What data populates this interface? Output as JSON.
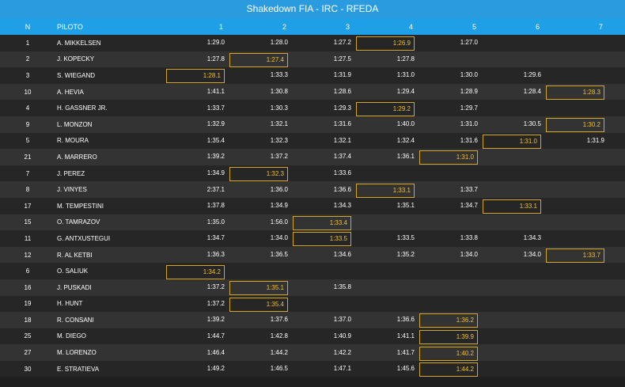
{
  "title": "Shakedown FIA - IRC - RFEDA",
  "header": {
    "n": "N",
    "piloto": "PILOTO",
    "cols": [
      "1",
      "2",
      "3",
      "4",
      "5",
      "6",
      "7"
    ]
  },
  "rows": [
    {
      "n": "1",
      "name": "A. MIKKELSEN",
      "t": [
        "1:29.0",
        "1:28.0",
        "1:27.2",
        "1:26.9",
        "1:27.0",
        "",
        ""
      ],
      "best": 3
    },
    {
      "n": "2",
      "name": "J. KOPECKY",
      "t": [
        "1:27.8",
        "1:27.4",
        "1:27.5",
        "1:27.8",
        "",
        "",
        ""
      ],
      "best": 1
    },
    {
      "n": "3",
      "name": "S. WIEGAND",
      "t": [
        "1:28.1",
        "1:33.3",
        "1:31.9",
        "1:31.0",
        "1:30.0",
        "1:29.6",
        ""
      ],
      "best": 0
    },
    {
      "n": "10",
      "name": "A. HEVIA",
      "t": [
        "1:41.1",
        "1:30.8",
        "1:28.6",
        "1:29.4",
        "1:28.9",
        "1:28.4",
        "1:28.3"
      ],
      "best": 6
    },
    {
      "n": "4",
      "name": "H. GASSNER JR.",
      "t": [
        "1:33.7",
        "1:30.3",
        "1:29.3",
        "1:29.2",
        "1:29.7",
        "",
        ""
      ],
      "best": 3
    },
    {
      "n": "9",
      "name": "L. MONZON",
      "t": [
        "1:32.9",
        "1:32.1",
        "1:31.6",
        "1:40.0",
        "1:31.0",
        "1:30.5",
        "1:30.2"
      ],
      "best": 6
    },
    {
      "n": "5",
      "name": "R. MOURA",
      "t": [
        "1:35.4",
        "1:32.3",
        "1:32.1",
        "1:32.4",
        "1:31.6",
        "1:31.0",
        "1:31.9"
      ],
      "best": 5
    },
    {
      "n": "21",
      "name": "A. MARRERO",
      "t": [
        "1:39.2",
        "1:37.2",
        "1:37.4",
        "1:36.1",
        "1:31.0",
        "",
        ""
      ],
      "best": 4
    },
    {
      "n": "7",
      "name": "J. PEREZ",
      "t": [
        "1:34.9",
        "1:32.3",
        "1:33.6",
        "",
        "",
        "",
        ""
      ],
      "best": 1
    },
    {
      "n": "8",
      "name": "J. VINYES",
      "t": [
        "2:37.1",
        "1:36.0",
        "1:36.6",
        "1:33.1",
        "1:33.7",
        "",
        ""
      ],
      "best": 3
    },
    {
      "n": "17",
      "name": "M. TEMPESTINI",
      "t": [
        "1:37.8",
        "1:34.9",
        "1:34.3",
        "1:35.1",
        "1:34.7",
        "1:33.1",
        ""
      ],
      "best": 5
    },
    {
      "n": "15",
      "name": "O. TAMRAZOV",
      "t": [
        "1:35.0",
        "1:56.0",
        "1:33.4",
        "",
        "",
        "",
        ""
      ],
      "best": 2
    },
    {
      "n": "11",
      "name": "G. ANTXUSTEGUI",
      "t": [
        "1:34.7",
        "1:34.0",
        "1:33.5",
        "1:33.5",
        "1:33.8",
        "1:34.3",
        ""
      ],
      "best": 2
    },
    {
      "n": "12",
      "name": "R. AL KETBI",
      "t": [
        "1:36.3",
        "1:36.5",
        "1:34.6",
        "1:35.2",
        "1:34.0",
        "1:34.0",
        "1:33.7"
      ],
      "best": 6
    },
    {
      "n": "6",
      "name": "O. SALIUK",
      "t": [
        "1:34.2",
        "",
        "",
        "",
        "",
        "",
        ""
      ],
      "best": 0
    },
    {
      "n": "16",
      "name": "J. PUSKADI",
      "t": [
        "1:37.2",
        "1:35.1",
        "1:35.8",
        "",
        "",
        "",
        ""
      ],
      "best": 1
    },
    {
      "n": "19",
      "name": "H. HUNT",
      "t": [
        "1:37.2",
        "1:35.4",
        "",
        "",
        "",
        "",
        ""
      ],
      "best": 1
    },
    {
      "n": "18",
      "name": "R. CONSANI",
      "t": [
        "1:39.2",
        "1:37.6",
        "1:37.0",
        "1:36.6",
        "1:36.2",
        "",
        ""
      ],
      "best": 4
    },
    {
      "n": "25",
      "name": "M. DIEGO",
      "t": [
        "1:44.7",
        "1:42.8",
        "1:40.9",
        "1:41.1",
        "1:39.9",
        "",
        ""
      ],
      "best": 4
    },
    {
      "n": "27",
      "name": "M. LORENZO",
      "t": [
        "1:46.4",
        "1:44.2",
        "1:42.2",
        "1:41.7",
        "1:40.2",
        "",
        ""
      ],
      "best": 4
    },
    {
      "n": "30",
      "name": "E. STRATIEVA",
      "t": [
        "1:49.2",
        "1:46.5",
        "1:47.1",
        "1:45.6",
        "1:44.2",
        "",
        ""
      ],
      "best": 4
    }
  ],
  "colors": {
    "title_bg": "#2b9be0",
    "header_bg": "#1fa0e6",
    "best_border": "#d4a820",
    "best_text": "#f2c12e",
    "row_odd": "#333333",
    "row_even": "#262626"
  }
}
